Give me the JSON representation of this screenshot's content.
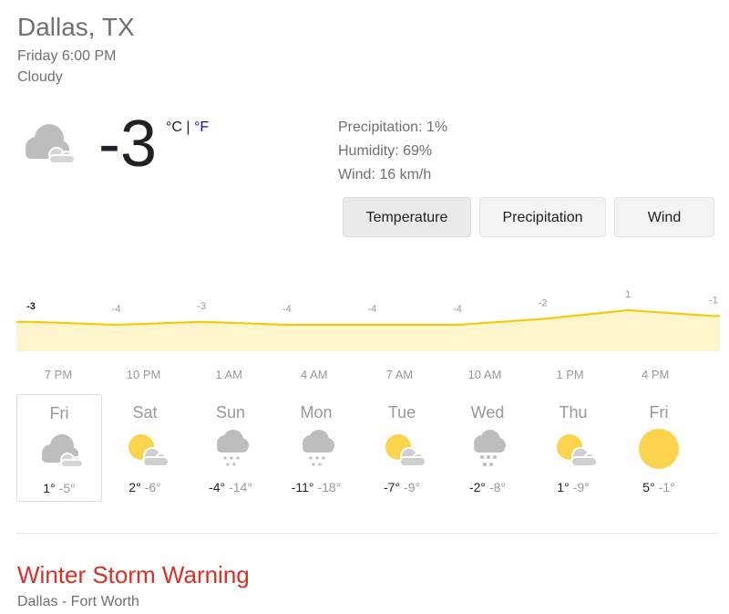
{
  "header": {
    "location": "Dallas, TX",
    "datetime": "Friday 6:00 PM",
    "condition": "Cloudy"
  },
  "current": {
    "icon": "cloudy-icon",
    "temperature": "-3",
    "unit_c": "°C",
    "unit_sep": " | ",
    "unit_f": "°F"
  },
  "details": {
    "precipitation": "Precipitation: 1%",
    "humidity": "Humidity: 69%",
    "wind": "Wind: 16 km/h"
  },
  "tabs": [
    {
      "label": "Temperature",
      "active": true
    },
    {
      "label": "Precipitation",
      "active": false
    },
    {
      "label": "Wind",
      "active": false
    }
  ],
  "chart_data": {
    "type": "area",
    "x": [
      "7 PM",
      "10 PM",
      "1 AM",
      "4 AM",
      "7 AM",
      "10 AM",
      "1 PM",
      "4 PM",
      ""
    ],
    "values": [
      -3,
      -4,
      -3,
      -4,
      -4,
      -4,
      -2,
      1,
      -1
    ],
    "labels": [
      "-3",
      "-4",
      "-3",
      "-4",
      "-4",
      "-4",
      "-2",
      "1",
      "-1"
    ],
    "colors": {
      "line": "#f6c700",
      "fill": "#fff5cc"
    }
  },
  "days": [
    {
      "name": "Fri",
      "icon": "cloudy-icon",
      "hi": "1°",
      "lo": "-5°",
      "selected": true
    },
    {
      "name": "Sat",
      "icon": "partly-sunny-icon",
      "hi": "2°",
      "lo": "-6°"
    },
    {
      "name": "Sun",
      "icon": "snow-icon",
      "hi": "-4°",
      "lo": "-14°"
    },
    {
      "name": "Mon",
      "icon": "snow-icon",
      "hi": "-11°",
      "lo": "-18°"
    },
    {
      "name": "Tue",
      "icon": "partly-sunny-icon",
      "hi": "-7°",
      "lo": "-9°"
    },
    {
      "name": "Wed",
      "icon": "snow-icon",
      "hi": "-2°",
      "lo": "-8°"
    },
    {
      "name": "Thu",
      "icon": "partly-sunny-icon",
      "hi": "1°",
      "lo": "-9°"
    },
    {
      "name": "Fri",
      "icon": "sunny-icon",
      "hi": "5°",
      "lo": "-1°"
    }
  ],
  "alert": {
    "title": "Winter Storm Warning",
    "area": "Dallas - Fort Worth",
    "color": "#d93025"
  }
}
